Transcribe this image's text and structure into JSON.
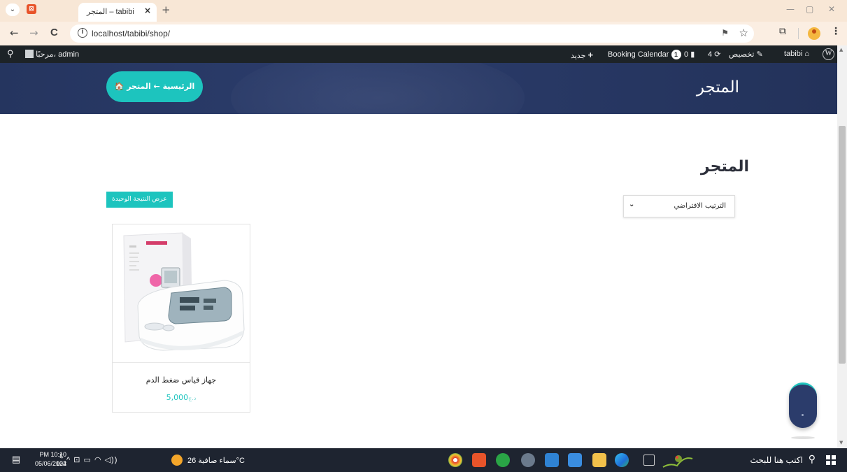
{
  "browser": {
    "tab_title": "المتجر – tabibi",
    "tab_close": "×",
    "new_tab": "+",
    "url": "localhost/tabibi/shop/",
    "info_icon": "i",
    "back": "←",
    "forward": "→",
    "reload": "C",
    "star": "☆",
    "translate": "⚑",
    "extensions": "⧉",
    "menu": "⋮",
    "minimize": "—",
    "maximize": "▢",
    "close": "✕",
    "tab_menu": "⌄"
  },
  "admin_bar": {
    "greeting": "مرحبًا، admin",
    "site_name": "tabibi",
    "customize": "تخصيص",
    "updates_count": "4",
    "comments_count": "0",
    "booking_badge": "1",
    "booking_calendar": "Booking Calendar",
    "new_label": "جديد",
    "new_plus": "+",
    "wp_logo": "W",
    "search_icon": "⚲"
  },
  "hero": {
    "title": "المتجر",
    "breadcrumb": "🏠 الرئيسية ← المتجر"
  },
  "shop": {
    "heading": "المتجر",
    "sort_selected": "الترتيب الافتراضي",
    "sort_chevron": "⌄",
    "result_count": "عرض النتيجة الوحيدة"
  },
  "products": [
    {
      "name": "جهاز قياس ضغط الدم",
      "price": "5,000",
      "currency": "د.ج"
    }
  ],
  "taskbar": {
    "search_placeholder": "اكتب هنا للبحث",
    "weather": "سماء صافية 26°C",
    "time": "PM 10:10",
    "date": "05/06/2024",
    "lang_top": "ع",
    "lang_bottom": "102",
    "tray": "^ ⊡ ▭ ◠ ◁))",
    "notify": "▤"
  },
  "colors": {
    "accent": "#1dc4be",
    "hero_bg": "#2b3c6b",
    "admin_bar": "#1d2327",
    "taskbar": "#1e2430"
  }
}
